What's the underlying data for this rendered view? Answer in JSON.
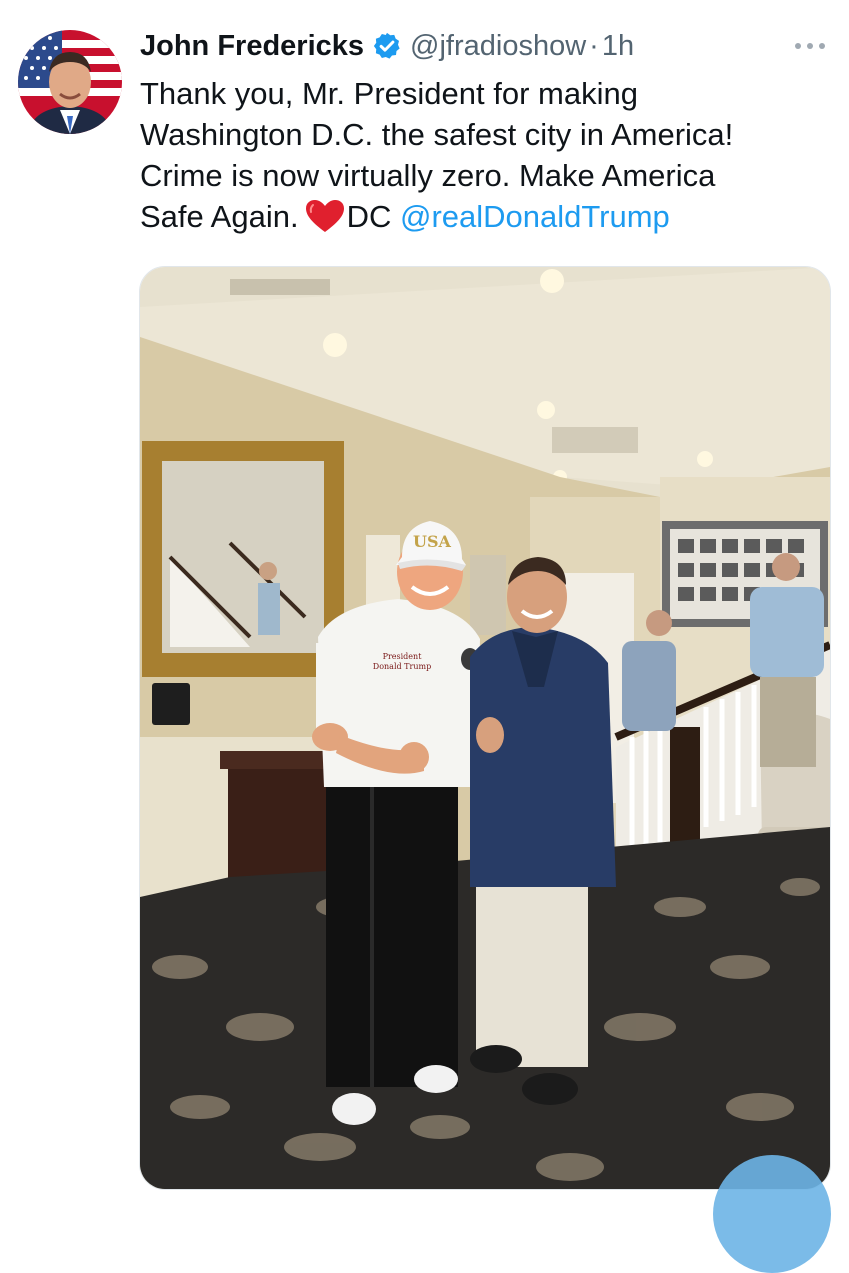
{
  "tweet": {
    "author": {
      "display_name": "John Fredericks",
      "handle": "@jfradioshow",
      "verified": true,
      "avatar": "author-avatar-photo"
    },
    "separator": "·",
    "timestamp": "1h",
    "more_icon": "more-horizontal-icon",
    "text": {
      "line1": "Thank you, Mr. President for making",
      "line2": "Washington D.C. the safest city in America!",
      "line3": "Crime is now virtually zero. Make America",
      "line4_before_heart": "Safe Again.",
      "heart_emoji": "red-heart-icon",
      "line4_after_heart": "DC",
      "mention": "@realDonaldTrump"
    },
    "media": {
      "type": "photo",
      "cap_text": "USA",
      "shirt_text": "President Donald Trump"
    }
  },
  "colors": {
    "text_primary": "#0f1419",
    "text_secondary": "#536471",
    "link": "#1d9bf0",
    "verified": "#1d9bf0"
  }
}
